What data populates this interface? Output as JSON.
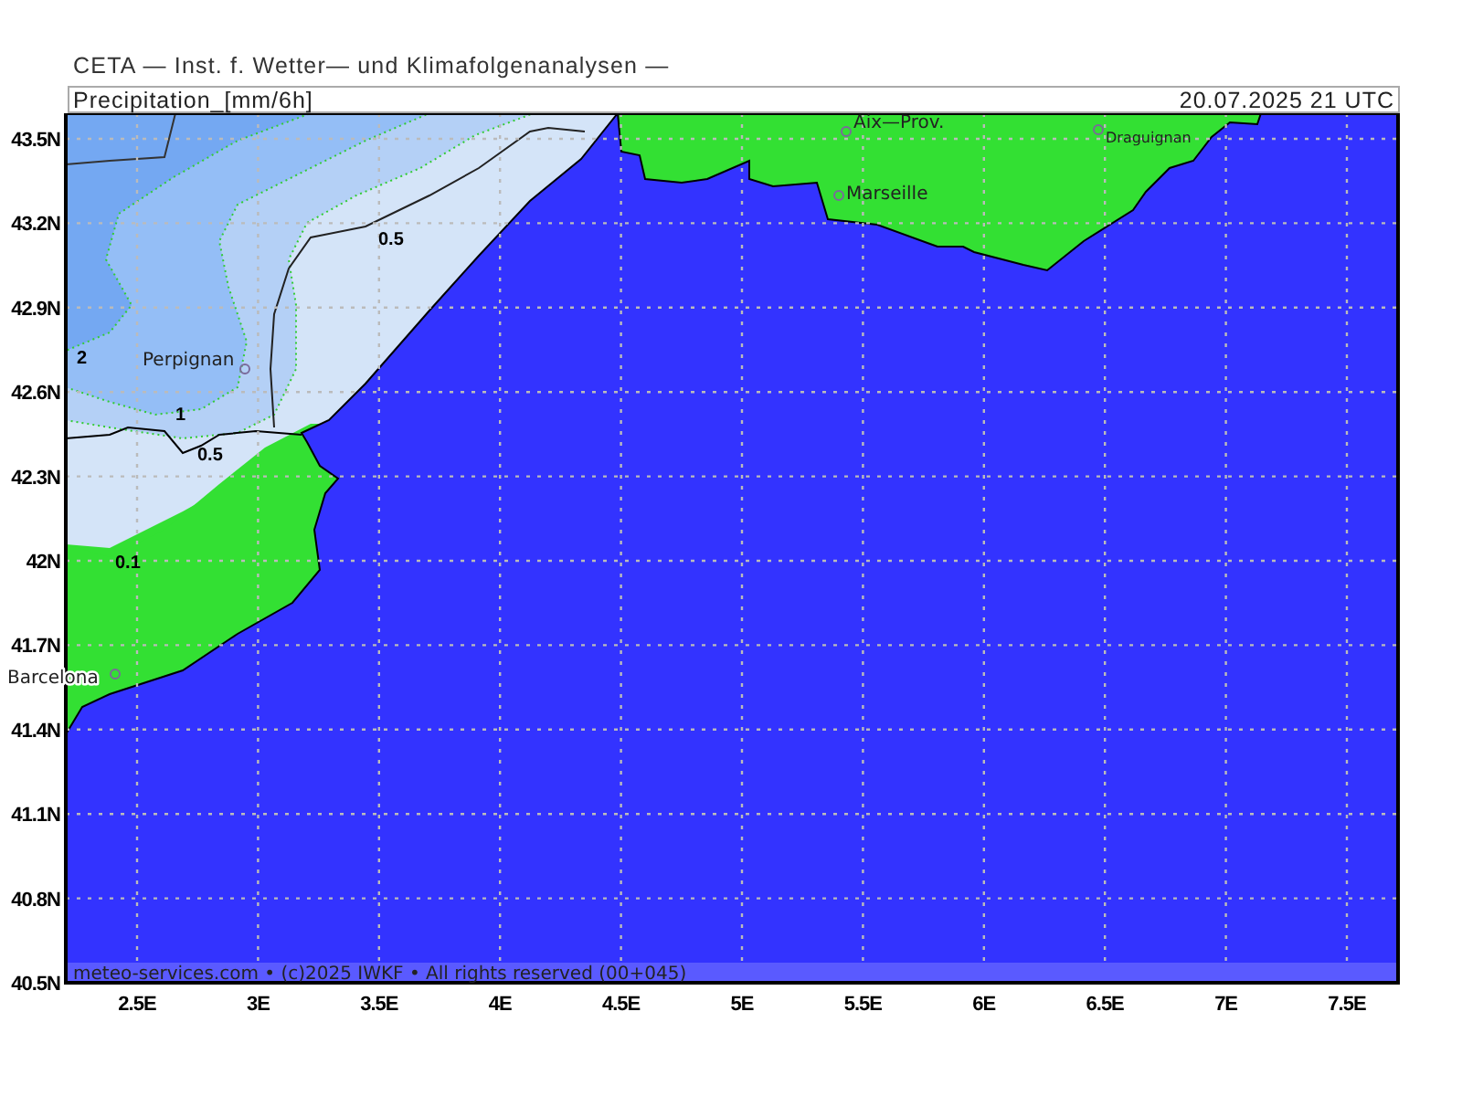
{
  "header": {
    "title": "CETA — Inst. f. Wetter— und Klimafolgenanalysen —"
  },
  "map": {
    "variable": "Precipitation_[mm/6h]",
    "valid_time": "20.07.2025 21 UTC",
    "lat_labels": [
      "43.5N",
      "43.2N",
      "42.9N",
      "42.6N",
      "42.3N",
      "42N",
      "41.7N",
      "41.4N",
      "41.1N",
      "40.8N",
      "40.5N"
    ],
    "lon_labels": [
      "2.5E",
      "3E",
      "3.5E",
      "4E",
      "4.5E",
      "5E",
      "5.5E",
      "6E",
      "6.5E",
      "7E",
      "7.5E"
    ],
    "places": [
      {
        "name": "Aix—Prov."
      },
      {
        "name": "Draguignan"
      },
      {
        "name": "Marseille"
      },
      {
        "name": "Perpignan"
      },
      {
        "name": "Barcelona"
      }
    ],
    "contour_labels": [
      "0.5",
      "2",
      "1",
      "0.5",
      "0.1"
    ],
    "footer": "meteo-services.com • (c)2025 IWKF • All rights reserved (00+045)"
  }
}
